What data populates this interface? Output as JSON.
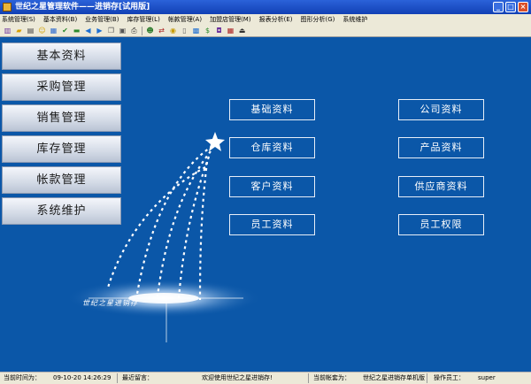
{
  "window": {
    "title": "世纪之星管理软件——进销存[试用版]"
  },
  "menu": [
    "系统管理(S)",
    "基本资料(B)",
    "业务管理(B)",
    "库存管理(L)",
    "帐款管理(A)",
    "加盟店管理(M)",
    "报表分析(E)",
    "图形分析(G)",
    "系统维护"
  ],
  "toolbar_icons": [
    "book-icon",
    "folder-icon",
    "notes-icon",
    "smiley-icon",
    "chart-icon",
    "check-icon",
    "money-icon",
    "left-arrow-icon",
    "right-arrow-icon",
    "copy-icon",
    "paste-icon",
    "print-icon",
    "people-icon",
    "transfer-icon",
    "coins-icon",
    "document-icon",
    "cards-icon",
    "dollar-icon",
    "safe-icon",
    "calendar-icon",
    "exit-icon"
  ],
  "sidebar": {
    "items": [
      {
        "label": "基本资料"
      },
      {
        "label": "采购管理"
      },
      {
        "label": "销售管理"
      },
      {
        "label": "库存管理"
      },
      {
        "label": "帐款管理"
      },
      {
        "label": "系统维护"
      }
    ]
  },
  "buttons": {
    "left": [
      "基础资料",
      "仓库资料",
      "客户资料",
      "员工资料"
    ],
    "right": [
      "公司资料",
      "产品资料",
      "供应商资料",
      "员工权限"
    ]
  },
  "logo_text": "世纪之星进销存",
  "status": {
    "time_label": "当前时间为：",
    "time_value": "09-10-20 14:26:29",
    "msg_label": "最近留言：",
    "welcome": "欢迎使用世纪之星进销存!",
    "account_label": "当前帐套为：",
    "account_value": "世纪之星进销存单机版",
    "operator_label": "操作员工：",
    "operator_value": "super"
  },
  "colors": {
    "background": "#0b57a8",
    "title_bar": "#1140b5"
  }
}
